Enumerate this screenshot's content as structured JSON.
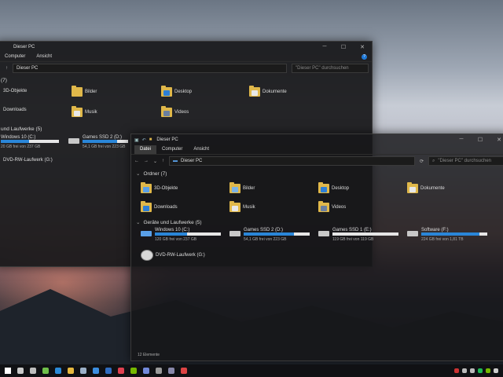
{
  "background_window": {
    "title": "Dieser PC",
    "ribbon_tabs": [
      "Computer",
      "Ansicht"
    ],
    "address": "Dieser PC",
    "search_placeholder": "\"Dieser PC\" durchsuchen",
    "folders": [
      {
        "label": "3D-Objekte"
      },
      {
        "label": "Bilder"
      },
      {
        "label": "Desktop"
      },
      {
        "label": "Dokumente"
      },
      {
        "label": "Downloads"
      },
      {
        "label": "Musik"
      },
      {
        "label": "Videos"
      }
    ],
    "folders_header": "(7)",
    "drives_header": "und Laufwerke (5)",
    "drives": [
      {
        "name": "Windows 10 (C:)",
        "free": "20 GB frei von 237 GB",
        "fill": 0.49
      },
      {
        "name": "Games SSD 2 (D:)",
        "free": "54,1 GB frei von 223 GB",
        "fill": 0.76
      }
    ],
    "dvd": "DVD-RW-Laufwerk (G:)"
  },
  "window": {
    "title": "Dieser PC",
    "ribbon_tabs": [
      "Datei",
      "Computer",
      "Ansicht"
    ],
    "address": "Dieser PC",
    "search_placeholder": "\"Dieser PC\" durchsuchen",
    "folders_header": "Ordner (7)",
    "folders": [
      {
        "label": "3D-Objekte",
        "badge": "#5aa0e8"
      },
      {
        "label": "Bilder",
        "badge": "#7bb3e6"
      },
      {
        "label": "Desktop",
        "badge": "#2d7fd6"
      },
      {
        "label": "Dokumente",
        "badge": "#e8e8e8"
      },
      {
        "label": "Downloads",
        "badge": "#2d7fd6"
      },
      {
        "label": "Musik",
        "badge": "#e8e8e8"
      },
      {
        "label": "Videos",
        "badge": "#6a7fa0"
      }
    ],
    "drives_header": "Geräte und Laufwerke (5)",
    "drives": [
      {
        "name": "Windows 10 (C:)",
        "free": "120 GB frei von 237 GB",
        "fill": 0.49
      },
      {
        "name": "Games SSD 2 (D:)",
        "free": "54,1 GB frei von 223 GB",
        "fill": 0.76
      },
      {
        "name": "Games SSD 1 (E:)",
        "free": "119 GB frei von 119 GB",
        "fill": 0.0
      },
      {
        "name": "Software (F:)",
        "free": "224 GB frei von 1,81 TB",
        "fill": 0.88
      }
    ],
    "dvd": "DVD-RW-Laufwerk (G:)",
    "status": "12 Elemente"
  },
  "taskbar": {
    "icons": [
      "start-icon",
      "search-icon",
      "task-view-icon",
      "xbox-icon",
      "edge-icon",
      "file-explorer-icon",
      "steam-icon",
      "store-icon",
      "mail-icon",
      "media-icon",
      "nvidia-icon",
      "discord-icon",
      "settings-icon",
      "camera-icon",
      "photos-icon"
    ],
    "colors": [
      "#ffffff",
      "#c9c9c9",
      "#bdbdbd",
      "#6fbf4a",
      "#2a8ad8",
      "#e7b93f",
      "#9bb0c8",
      "#3b8ee0",
      "#2f6cc0",
      "#e04050",
      "#76b900",
      "#7289da",
      "#9a9a9a",
      "#8888aa",
      "#d44"
    ],
    "tray_icons": [
      "security-icon",
      "network-icon",
      "volume-icon",
      "spotify-icon",
      "gpu-icon",
      "notification-icon"
    ],
    "tray_colors": [
      "#cc3333",
      "#bbbbbb",
      "#bbbbbb",
      "#1db954",
      "#76b900",
      "#cccccc"
    ]
  }
}
